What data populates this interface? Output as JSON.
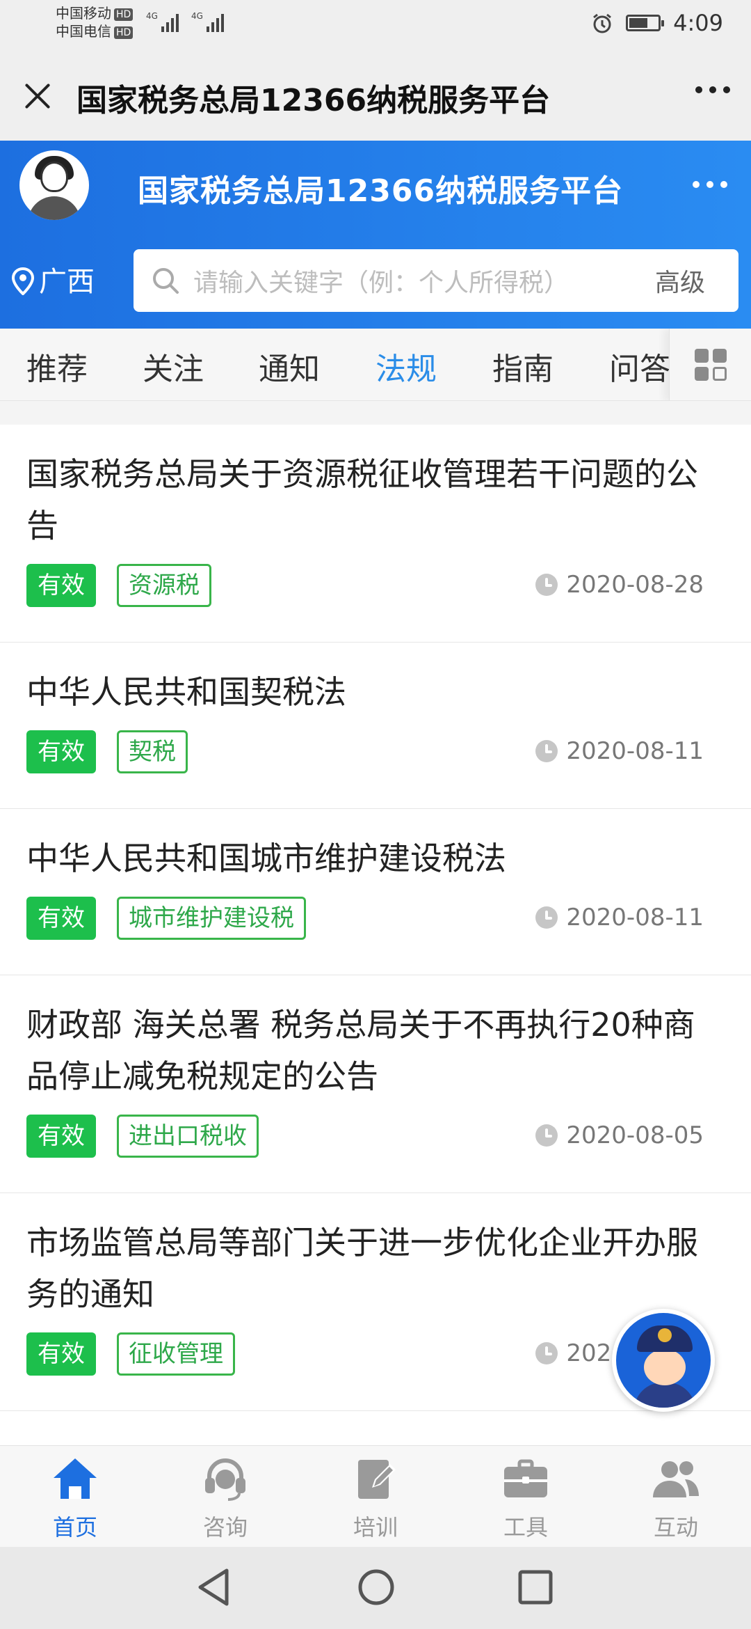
{
  "status_bar": {
    "carrier1": "中国移动",
    "carrier2": "中国电信",
    "hd": "HD",
    "net": "4G",
    "time": "4:09",
    "battery_level": 0.65
  },
  "titlebar": {
    "title": "国家税务总局12366纳税服务平台"
  },
  "header": {
    "title": "国家税务总局12366纳税服务平台",
    "location": "广西",
    "search_placeholder": "请输入关键字（例：个人所得税）",
    "advanced_label": "高级"
  },
  "tabs": [
    {
      "label": "推荐"
    },
    {
      "label": "关注"
    },
    {
      "label": "通知"
    },
    {
      "label": "法规"
    },
    {
      "label": "指南"
    },
    {
      "label": "问答"
    }
  ],
  "active_tab": "法规",
  "list": [
    {
      "title": "国家税务总局关于资源税征收管理若干问题的公告",
      "status": "有效",
      "tag": "资源税",
      "date": "2020-08-28"
    },
    {
      "title": "中华人民共和国契税法",
      "status": "有效",
      "tag": "契税",
      "date": "2020-08-11"
    },
    {
      "title": "中华人民共和国城市维护建设税法",
      "status": "有效",
      "tag": "城市维护建设税",
      "date": "2020-08-11"
    },
    {
      "title": "财政部 海关总署 税务总局关于不再执行20种商品停止减免税规定的公告",
      "status": "有效",
      "tag": "进出口税收",
      "date": "2020-08-05"
    },
    {
      "title": "市场监管总局等部门关于进一步优化企业开办服务的通知",
      "status": "有效",
      "tag": "征收管理",
      "date": "2020-08-04"
    }
  ],
  "bottom_nav": [
    {
      "label": "首页",
      "icon": "home-icon"
    },
    {
      "label": "咨询",
      "icon": "headset-icon"
    },
    {
      "label": "培训",
      "icon": "edit-icon"
    },
    {
      "label": "工具",
      "icon": "briefcase-icon"
    },
    {
      "label": "互动",
      "icon": "users-icon"
    }
  ],
  "colors": {
    "brand_blue": "#1d6fe0",
    "active_tab": "#2b8de8",
    "valid_green": "#1dbf4c"
  }
}
